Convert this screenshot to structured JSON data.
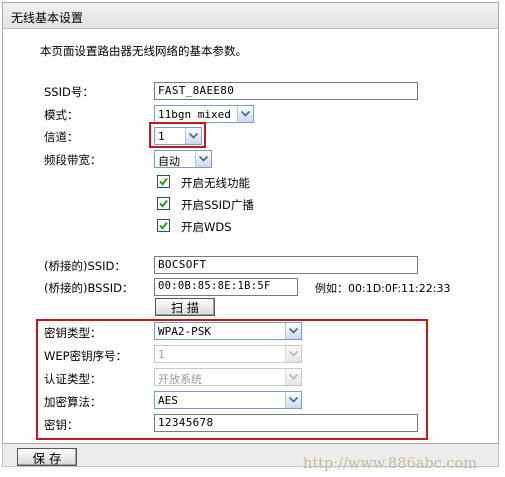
{
  "panel": {
    "title": "无线基本设置"
  },
  "intro": "本页面设置路由器无线网络的基本参数。",
  "fields": {
    "ssid": {
      "label": "SSID号：",
      "value": "FAST_8AEE80"
    },
    "mode": {
      "label": "模式：",
      "value": "11bgn mixed"
    },
    "channel": {
      "label": "信道：",
      "value": "1"
    },
    "bandwidth": {
      "label": "频段带宽：",
      "value": "自动"
    }
  },
  "checkboxes": {
    "wireless": {
      "label": "开启无线功能",
      "checked": true
    },
    "ssid_broadcast": {
      "label": "开启SSID广播",
      "checked": true
    },
    "wds": {
      "label": "开启WDS",
      "checked": true
    }
  },
  "bridge": {
    "ssid_label": "(桥接的)SSID：",
    "ssid_value": "BOCSOFT",
    "bssid_label": "(桥接的)BSSID：",
    "bssid_value": "00:0B:85:8E:1B:5F",
    "bssid_hint": "例如：00:1D:0F:11:22:33",
    "scan_label": "扫 描"
  },
  "security": {
    "key_type_label": "密钥类型：",
    "key_type_value": "WPA2-PSK",
    "wep_index_label": "WEP密钥序号：",
    "wep_index_value": "1",
    "auth_type_label": "认证类型：",
    "auth_type_value": "开放系统",
    "encryption_label": "加密算法：",
    "encryption_value": "AES",
    "key_label": "密钥：",
    "key_value": "12345678"
  },
  "save_label": "保 存",
  "watermark": "http://www.886abc.com",
  "colors": {
    "highlight_border": "#c0191e",
    "checkbox_check": "#21a121"
  }
}
